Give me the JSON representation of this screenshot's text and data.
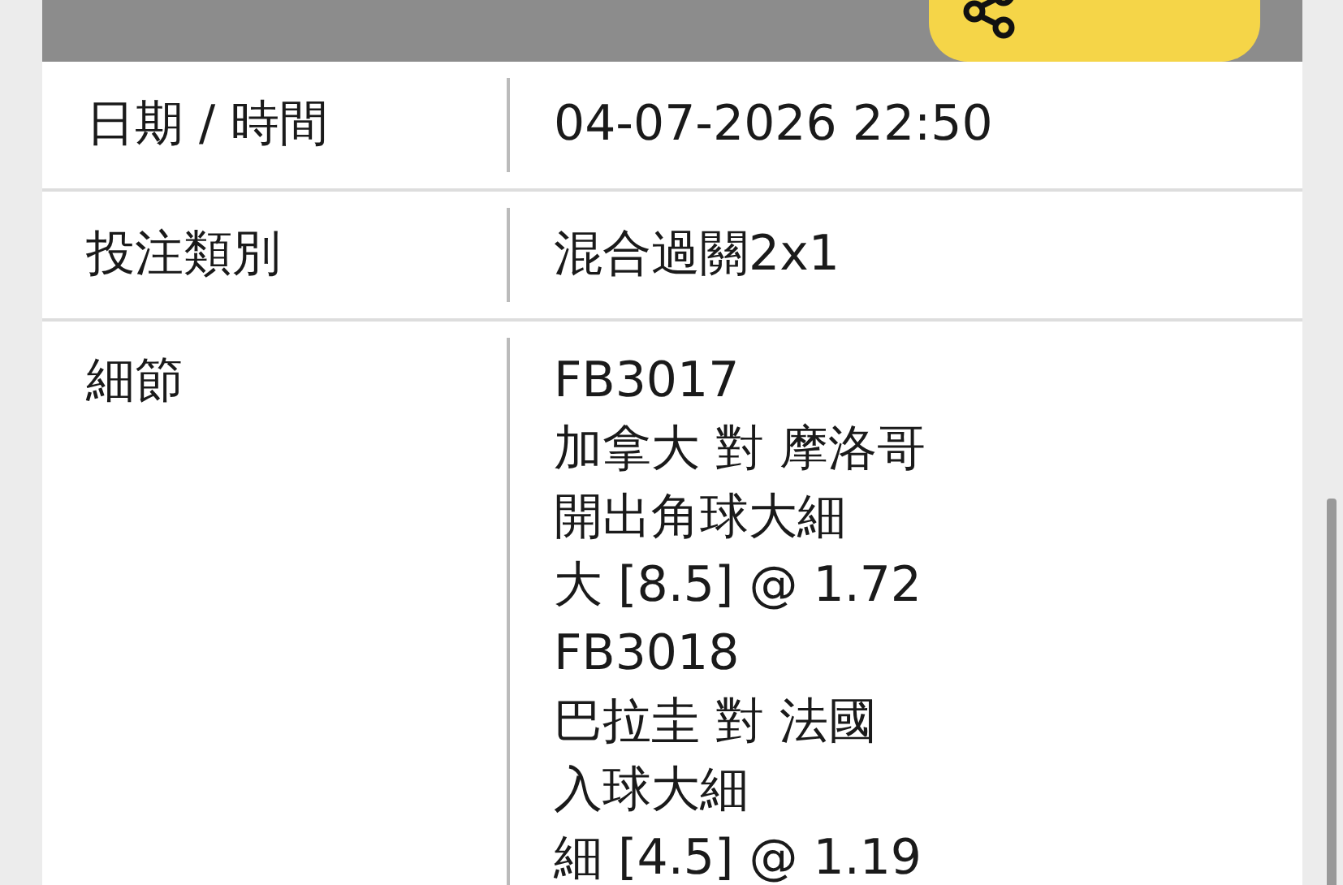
{
  "rows": [
    {
      "label": "日期 / 時間",
      "lines": [
        "04-07-2026 22:50"
      ]
    },
    {
      "label": "投注類別",
      "lines": [
        "混合過關2x1"
      ]
    },
    {
      "label": "細節",
      "lines": [
        "FB3017",
        "加拿大 對 摩洛哥",
        "開出角球大細",
        "大 [8.5] @ 1.72",
        "FB3018",
        "巴拉圭 對 法國",
        "入球大細",
        "細 [4.5] @ 1.19"
      ]
    }
  ]
}
